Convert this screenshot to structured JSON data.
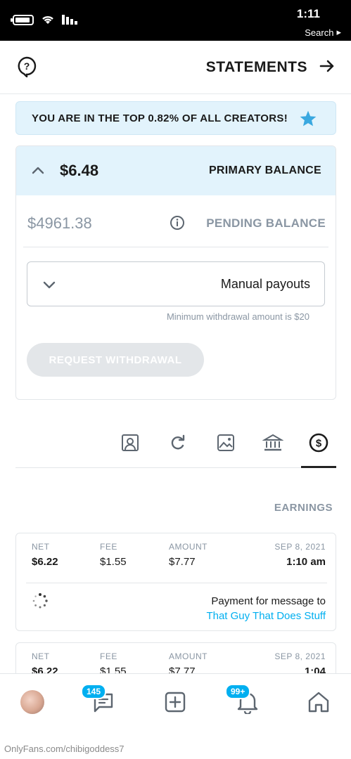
{
  "status_bar": {
    "time": "1:11",
    "back_app": "Search"
  },
  "header": {
    "title": "STATEMENTS"
  },
  "banner": {
    "text": "YOU ARE IN THE TOP 0.82% OF ALL CREATORS!"
  },
  "balance": {
    "primary_label": "PRIMARY BALANCE",
    "primary_amount": "$6.48",
    "pending_label": "PENDING BALANCE",
    "pending_amount": "$4961.38",
    "payout_method": "Manual payouts",
    "min_note": "Minimum withdrawal amount is $20",
    "withdraw_button": "REQUEST WITHDRAWAL"
  },
  "tabs": [
    "earnings-icon",
    "bank-icon",
    "image-icon",
    "redo-icon",
    "user-frame-icon"
  ],
  "earnings": {
    "title": "EARNINGS",
    "headers": {
      "date": "SEP 8, 2021",
      "amount": "AMOUNT",
      "fee": "FEE",
      "net": "NET"
    },
    "rows": [
      {
        "date": "SEP 8, 2021",
        "time": "1:10 am",
        "amount": "$7.77",
        "fee": "$1.55",
        "net": "$6.22",
        "description": "Payment for message to",
        "link": "That Guy That Does Stuff"
      },
      {
        "date": "SEP 8, 2021",
        "time": "1:04",
        "amount": "$7.77",
        "fee": "$1.55",
        "net": "$6.22"
      }
    ]
  },
  "bottom_nav": {
    "messages_badge": "145",
    "notifications_badge": "99+"
  },
  "watermark": "OnlyFans.com/chibigoddess7",
  "colors": {
    "accent": "#00aff0",
    "banner_bg": "#e2f3fc",
    "muted": "#8a96a3"
  }
}
